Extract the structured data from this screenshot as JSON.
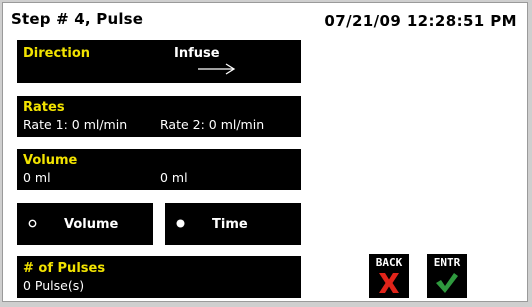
{
  "header": {
    "title": "Step # 4, Pulse",
    "datetime": "07/21/09 12:28:51 PM"
  },
  "direction": {
    "label": "Direction",
    "value": "Infuse",
    "arrow_icon": "right-arrow-icon"
  },
  "rates": {
    "label": "Rates",
    "rate1": "Rate 1: 0 ml/min",
    "rate2": "Rate 2: 0 ml/min"
  },
  "volume": {
    "label": "Volume",
    "value1": "0 ml",
    "value2": "0 ml"
  },
  "mode_options": {
    "volume_label": "Volume",
    "time_label": "Time",
    "selected": "Time"
  },
  "pulses": {
    "label": "# of Pulses",
    "value": "0 Pulse(s)"
  },
  "buttons": {
    "back_label": "BACK",
    "back_icon": "red-x-icon",
    "entr_label": "ENTR",
    "entr_icon": "green-check-icon"
  },
  "colors": {
    "panel_bg": "#000000",
    "label_yellow": "#f2e300",
    "back_red": "#e0241a",
    "entr_green": "#2f9a3e"
  }
}
